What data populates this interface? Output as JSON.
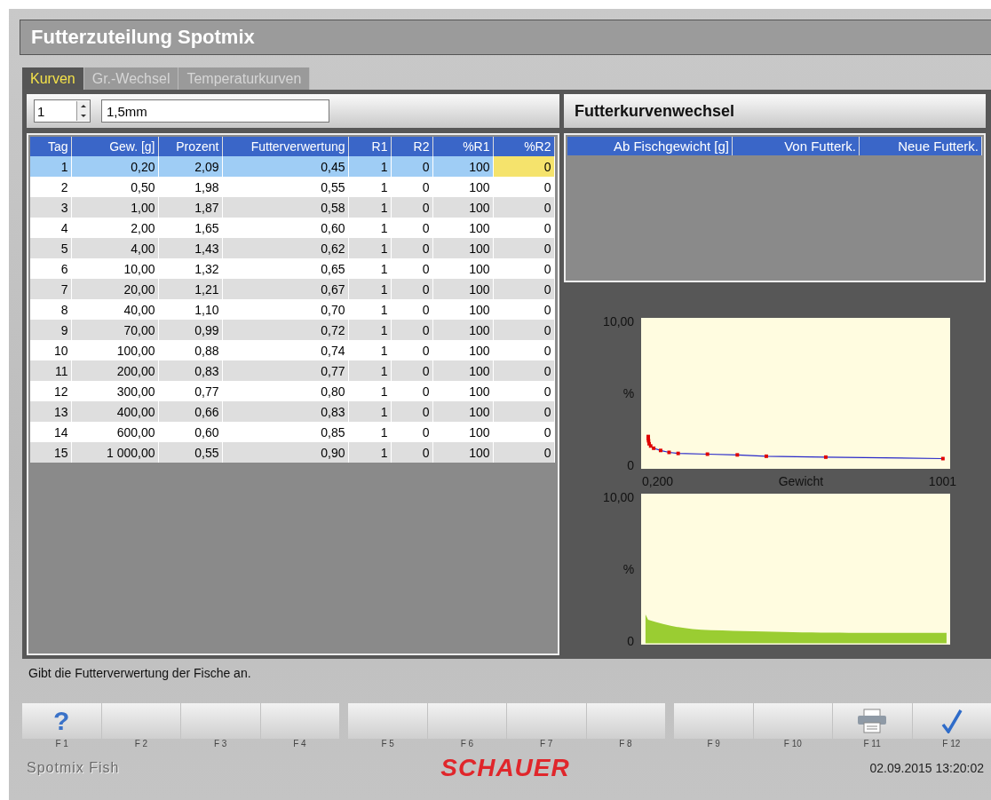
{
  "window": {
    "title": "Futterzuteilung Spotmix"
  },
  "tabs": [
    {
      "label": "Kurven",
      "selected": true
    },
    {
      "label": "Gr.-Wechsel",
      "selected": false
    },
    {
      "label": "Temperaturkurven",
      "selected": false
    }
  ],
  "curve_selector": {
    "number": "1",
    "name": "1,5mm"
  },
  "table": {
    "columns": [
      "Tag",
      "Gew. [g]",
      "Prozent",
      "Futterverwertung",
      "R1",
      "R2",
      "%R1",
      "%R2"
    ],
    "rows": [
      {
        "cells": [
          "1",
          "0,20",
          "2,09",
          "0,45",
          "1",
          "0",
          "100",
          "0"
        ],
        "selected": true,
        "editing_last_cell": true
      },
      {
        "cells": [
          "2",
          "0,50",
          "1,98",
          "0,55",
          "1",
          "0",
          "100",
          "0"
        ],
        "selected": false,
        "editing_last_cell": false
      },
      {
        "cells": [
          "3",
          "1,00",
          "1,87",
          "0,58",
          "1",
          "0",
          "100",
          "0"
        ],
        "selected": false,
        "editing_last_cell": false
      },
      {
        "cells": [
          "4",
          "2,00",
          "1,65",
          "0,60",
          "1",
          "0",
          "100",
          "0"
        ],
        "selected": false,
        "editing_last_cell": false
      },
      {
        "cells": [
          "5",
          "4,00",
          "1,43",
          "0,62",
          "1",
          "0",
          "100",
          "0"
        ],
        "selected": false,
        "editing_last_cell": false
      },
      {
        "cells": [
          "6",
          "10,00",
          "1,32",
          "0,65",
          "1",
          "0",
          "100",
          "0"
        ],
        "selected": false,
        "editing_last_cell": false
      },
      {
        "cells": [
          "7",
          "20,00",
          "1,21",
          "0,67",
          "1",
          "0",
          "100",
          "0"
        ],
        "selected": false,
        "editing_last_cell": false
      },
      {
        "cells": [
          "8",
          "40,00",
          "1,10",
          "0,70",
          "1",
          "0",
          "100",
          "0"
        ],
        "selected": false,
        "editing_last_cell": false
      },
      {
        "cells": [
          "9",
          "70,00",
          "0,99",
          "0,72",
          "1",
          "0",
          "100",
          "0"
        ],
        "selected": false,
        "editing_last_cell": false
      },
      {
        "cells": [
          "10",
          "100,00",
          "0,88",
          "0,74",
          "1",
          "0",
          "100",
          "0"
        ],
        "selected": false,
        "editing_last_cell": false
      },
      {
        "cells": [
          "11",
          "200,00",
          "0,83",
          "0,77",
          "1",
          "0",
          "100",
          "0"
        ],
        "selected": false,
        "editing_last_cell": false
      },
      {
        "cells": [
          "12",
          "300,00",
          "0,77",
          "0,80",
          "1",
          "0",
          "100",
          "0"
        ],
        "selected": false,
        "editing_last_cell": false
      },
      {
        "cells": [
          "13",
          "400,00",
          "0,66",
          "0,83",
          "1",
          "0",
          "100",
          "0"
        ],
        "selected": false,
        "editing_last_cell": false
      },
      {
        "cells": [
          "14",
          "600,00",
          "0,60",
          "0,85",
          "1",
          "0",
          "100",
          "0"
        ],
        "selected": false,
        "editing_last_cell": false
      },
      {
        "cells": [
          "15",
          "1 000,00",
          "0,55",
          "0,90",
          "1",
          "0",
          "100",
          "0"
        ],
        "selected": false,
        "editing_last_cell": false
      }
    ]
  },
  "change_panel": {
    "title": "Futterkurvenwechsel",
    "columns": [
      "Ab Fischgewicht [g]",
      "Von Futterk.",
      "Neue Futterk."
    ]
  },
  "charts": [
    {
      "kind": "line",
      "y_ticks": [
        "10,00",
        "0"
      ],
      "y_unit": "%",
      "x_ticks": [
        "0,200",
        "1001"
      ],
      "x_title": "Gewicht"
    },
    {
      "kind": "area",
      "y_ticks": [
        "10,00",
        "0"
      ],
      "y_unit": "%"
    }
  ],
  "status_text": "Gibt die Futterverwertung der Fische an.",
  "function_keys": [
    {
      "key": "F 1",
      "kind": "help",
      "glyph": "?"
    },
    {
      "key": "F 2",
      "kind": "blank"
    },
    {
      "key": "F 3",
      "kind": "blank"
    },
    {
      "key": "F 4",
      "kind": "blank"
    },
    {
      "key": "F 5",
      "kind": "blank"
    },
    {
      "key": "F 6",
      "kind": "blank"
    },
    {
      "key": "F 7",
      "kind": "blank"
    },
    {
      "key": "F 8",
      "kind": "blank"
    },
    {
      "key": "F 9",
      "kind": "blank"
    },
    {
      "key": "F 10",
      "kind": "blank"
    },
    {
      "key": "F 11",
      "kind": "print"
    },
    {
      "key": "F 12",
      "kind": "confirm"
    }
  ],
  "footer": {
    "app_name": "Spotmix Fish",
    "logo": "SCHAUER",
    "datetime": "02.09.2015 13:20:02"
  }
}
